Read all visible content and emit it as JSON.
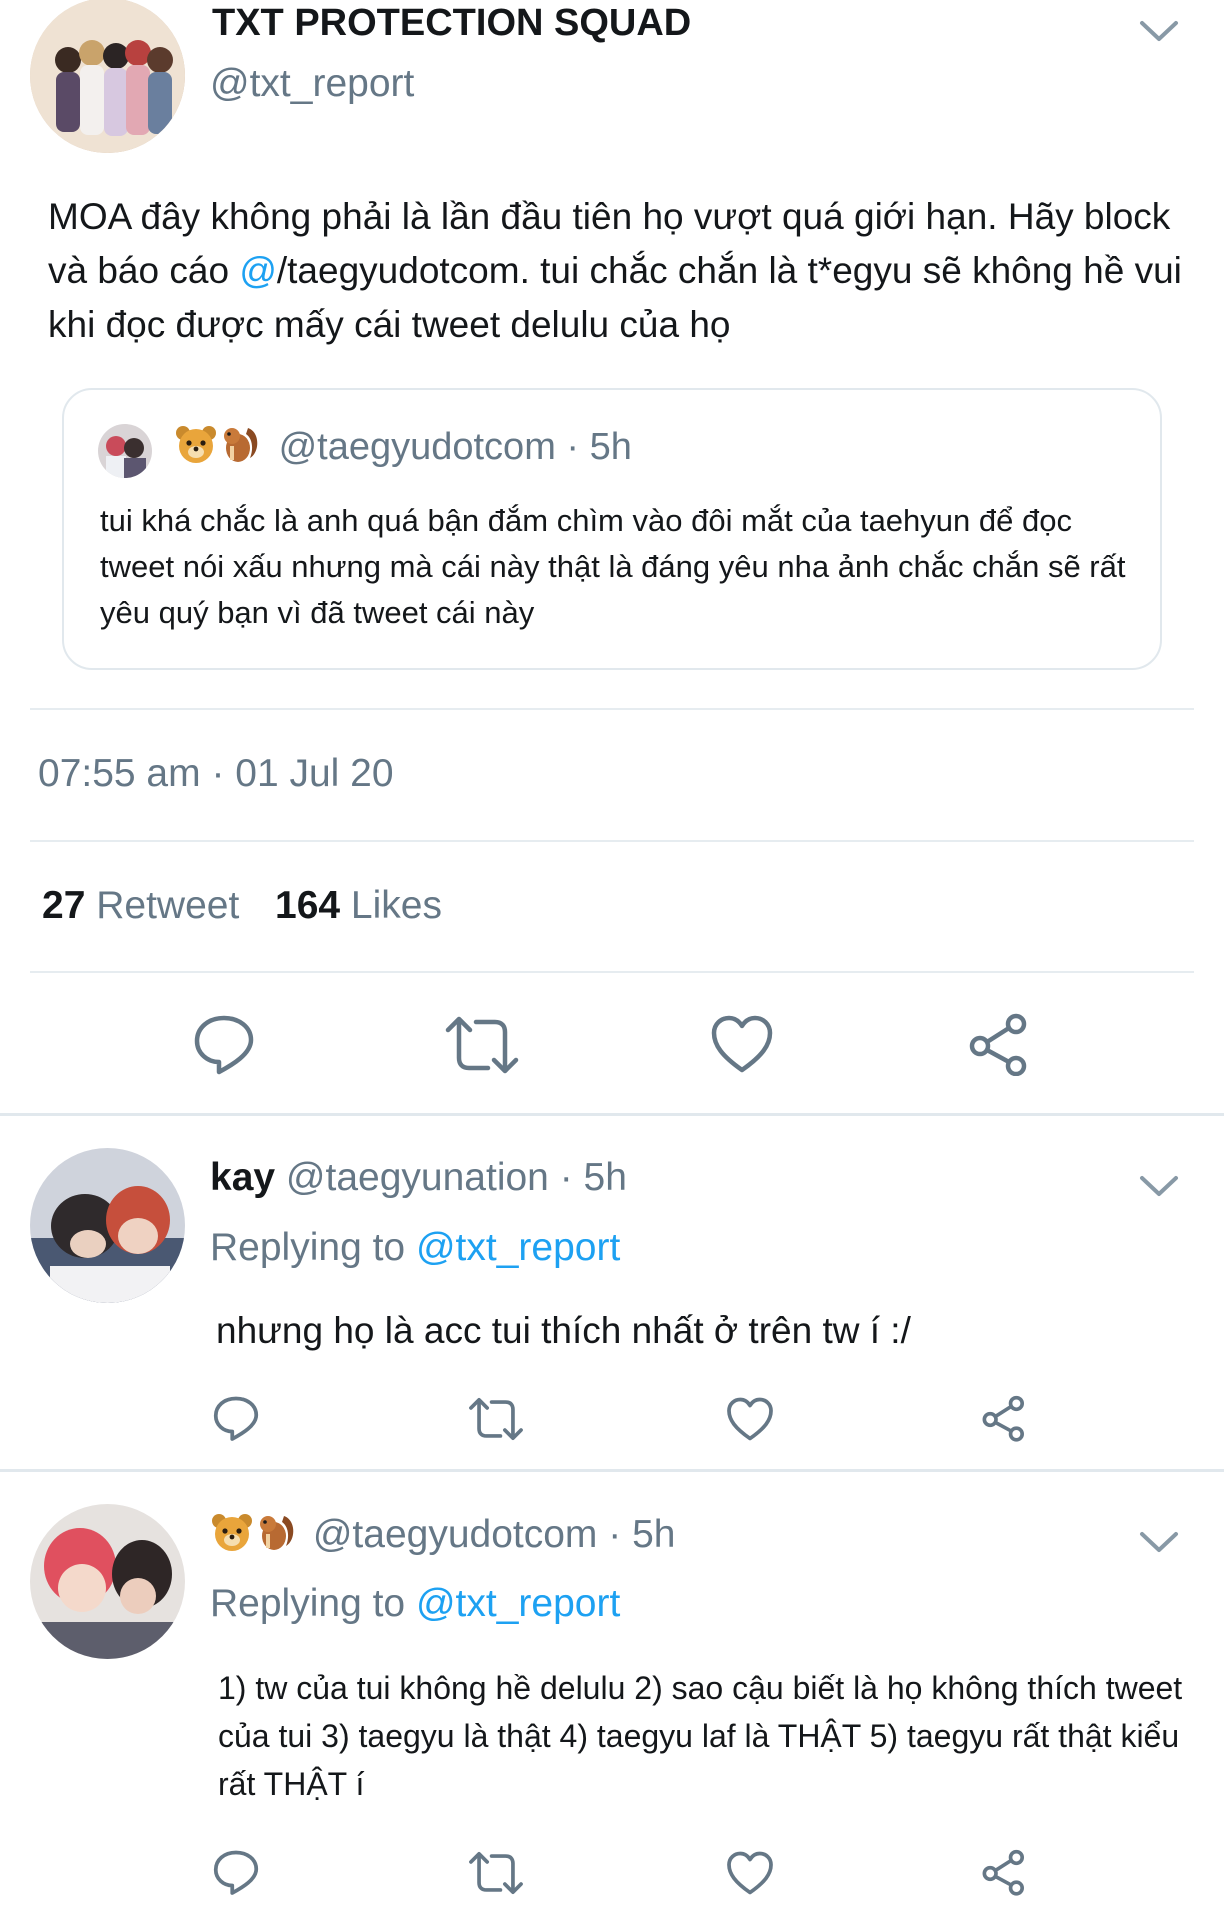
{
  "main_tweet": {
    "display_name": "TXT PROTECTION SQUAD",
    "handle": "@txt_report",
    "text_before_mention": "MOA đây không phải là lần đầu tiên họ vượt quá giới hạn. Hãy block và báo cáo ",
    "mention_at": "@",
    "text_after_mention": "/taegyudotcom. tui chắc chắn là t*egyu sẽ không hề vui khi đọc được mấy cái tweet delulu của họ",
    "quoted": {
      "handle_time": "@taegyudotcom · 5h",
      "text": "tui khá chắc là anh quá bận đắm chìm vào đôi mắt của taehyun để đọc tweet nói xấu nhưng mà cái này thật là đáng yêu nha ảnh chắc chắn sẽ rất yêu quý bạn vì đã tweet cái này"
    },
    "timestamp": "07:55 am · 01 Jul 20",
    "retweet_count": "27",
    "retweet_label": "Retweet",
    "like_count": "164",
    "like_label": "Likes"
  },
  "replies": [
    {
      "display_name": "kay",
      "handle_time": "@taegyunation · 5h",
      "replying_label": "Replying to ",
      "replying_handle": "@txt_report",
      "text": "nhưng họ là acc tui thích nhất ở trên tw í :/"
    },
    {
      "handle_time": "@taegyudotcom · 5h",
      "replying_label": "Replying to ",
      "replying_handle": "@txt_report",
      "text": "1) tw của tui không hề delulu 2) sao cậu biết là họ không thích tweet của tui 3) taegyu là thật 4) taegyu laf là THẬT 5) taegyu rất thật kiểu rất THẬT í"
    }
  ],
  "colors": {
    "accent": "#1da1f2",
    "secondary_text": "#657786",
    "divider": "#e6ecf0"
  },
  "icons": [
    "chevron-down-icon",
    "reply-icon",
    "retweet-icon",
    "heart-icon",
    "share-icon",
    "bear-emoji",
    "chipmunk-emoji"
  ]
}
